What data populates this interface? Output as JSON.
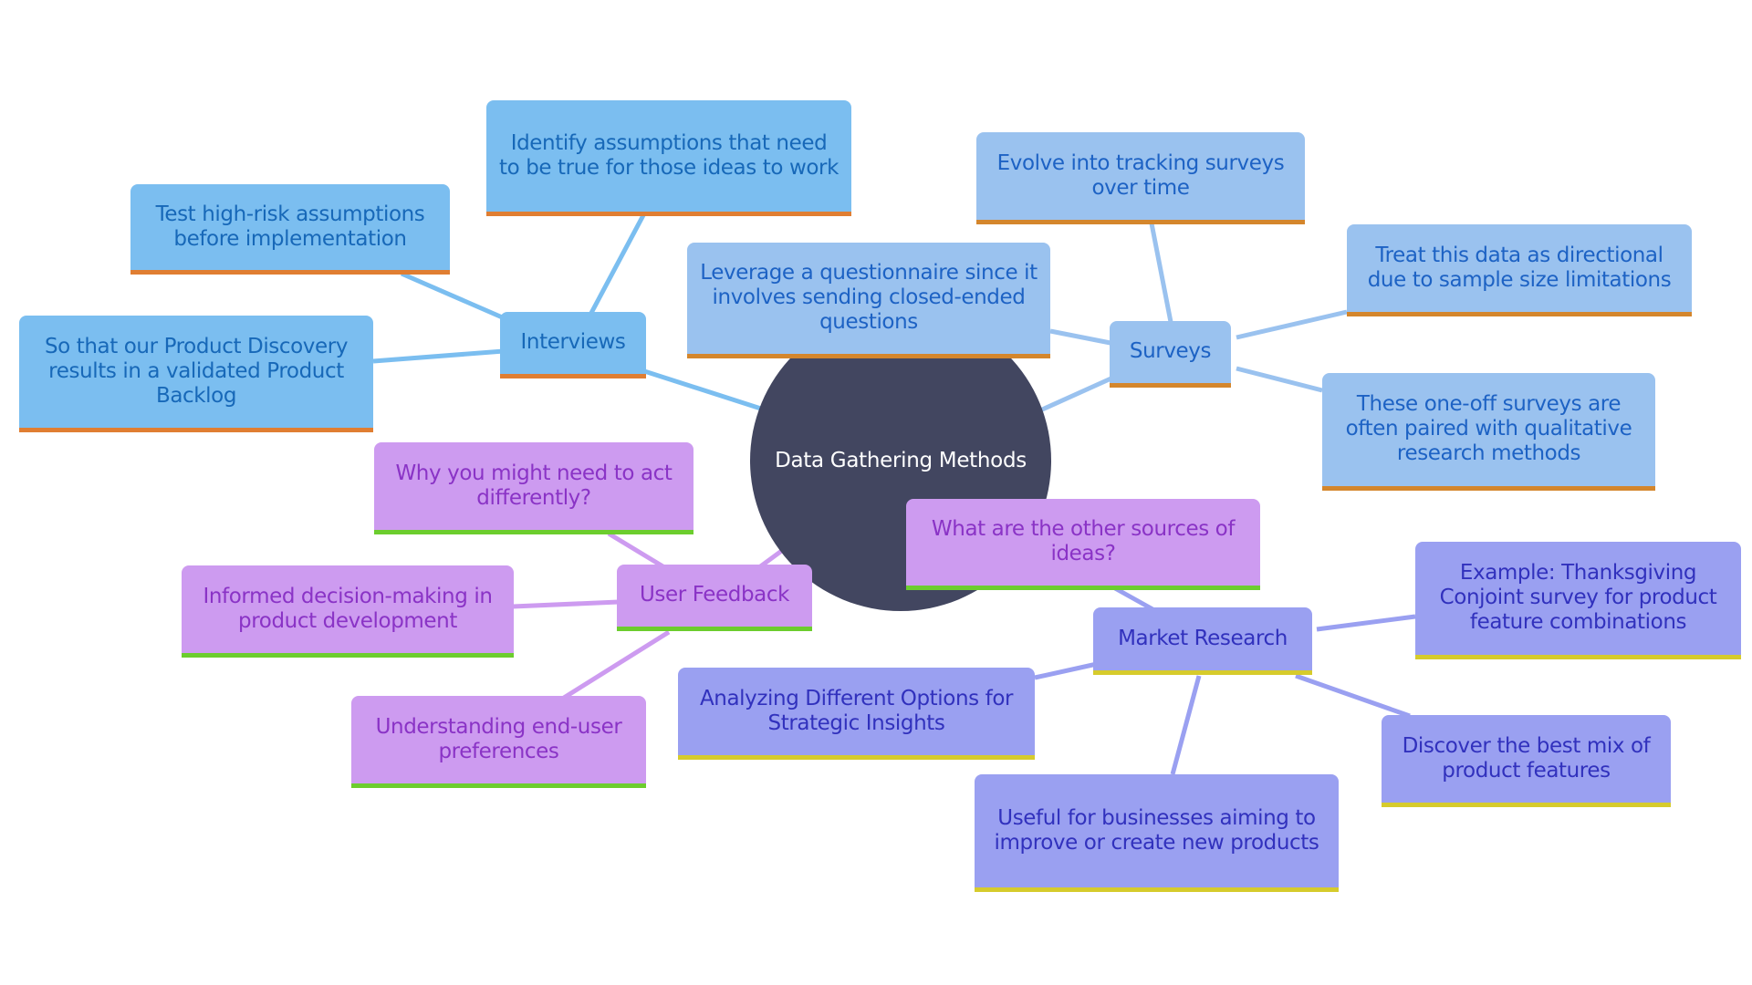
{
  "diagram": {
    "type": "mindmap",
    "root": "Data Gathering Methods",
    "colors": {
      "root_fill": "#424660",
      "interviews_fill": "#7bbef0",
      "interviews_accent": "#e07e32",
      "surveys_fill": "#9ac2ef",
      "surveys_accent": "#d4862c",
      "user_feedback_fill": "#cd9bf0",
      "user_feedback_accent": "#6ccd2e",
      "market_research_fill": "#9aa0f1",
      "market_research_accent": "#d6cb2c"
    },
    "branches": {
      "interviews": {
        "label": "Interviews",
        "children": [
          "Identify assumptions that need to be true for those ideas to work",
          "Test high-risk assumptions before implementation",
          "So that our Product Discovery results in a validated Product Backlog"
        ]
      },
      "surveys": {
        "label": "Surveys",
        "children": [
          "Leverage a questionnaire since it involves sending closed-ended questions",
          "Evolve into tracking surveys over time",
          "Treat this data as directional due to sample size limitations",
          "These one-off surveys are often paired with qualitative research methods"
        ]
      },
      "user_feedback": {
        "label": "User Feedback",
        "children": [
          "Why you might need to act differently?",
          "Informed decision-making in product development",
          "Understanding end-user preferences"
        ]
      },
      "market_research": {
        "label": "Market Research",
        "children": [
          "What are the other sources of ideas?",
          "Example: Thanksgiving Conjoint survey for product feature combinations",
          "Analyzing Different Options for Strategic Insights",
          "Discover the best mix of product features",
          "Useful for businesses aiming to improve or create new products"
        ]
      }
    }
  }
}
